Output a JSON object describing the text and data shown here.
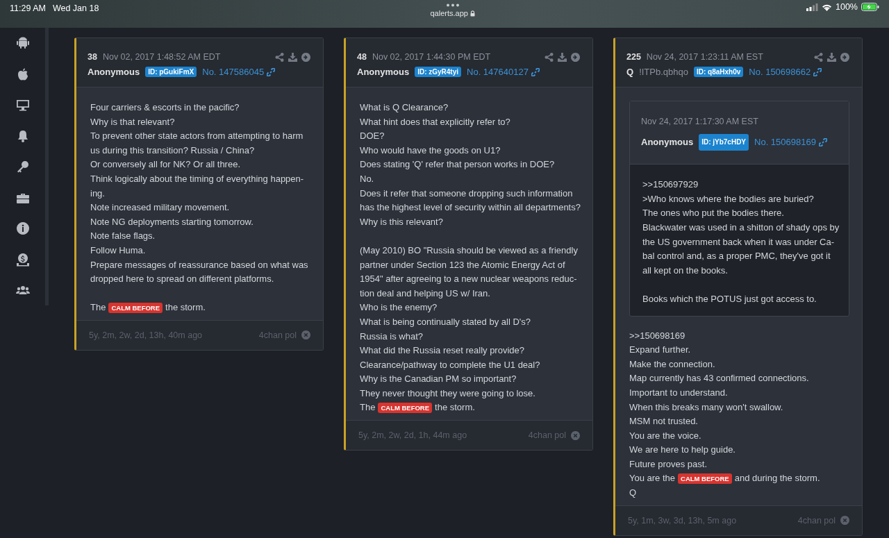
{
  "status_bar": {
    "time": "11:29 AM",
    "date": "Wed Jan 18",
    "url": "qalerts.app",
    "battery": "100%"
  },
  "posts": [
    {
      "number": "38",
      "date": "Nov 02, 2017 1:48:52 AM EDT",
      "author": "Anonymous",
      "id_badge": "ID: pGukiFmX",
      "post_no": "No. 147586045",
      "lines": [
        {
          "kind": "text",
          "text": "Four carriers & escorts in the pacific?"
        },
        {
          "kind": "text",
          "text": "Why is that relevant?"
        },
        {
          "kind": "text",
          "text": "To prevent other state actors from attempting to harm"
        },
        {
          "kind": "text",
          "text": "us during this transition? Russia / China?"
        },
        {
          "kind": "text",
          "text": "Or conversely all for NK? Or all three."
        },
        {
          "kind": "text",
          "text": "Think logically about the timing of everything happen-"
        },
        {
          "kind": "text",
          "text": "ing."
        },
        {
          "kind": "text",
          "text": "Note increased military movement."
        },
        {
          "kind": "text",
          "text": "Note NG deployments starting tomorrow."
        },
        {
          "kind": "text",
          "text": "Note false flags."
        },
        {
          "kind": "text",
          "text": "Follow Huma."
        },
        {
          "kind": "text",
          "text": "Prepare messages of reassurance based on what was"
        },
        {
          "kind": "text",
          "text": "dropped here to spread on different platforms."
        },
        {
          "kind": "gap"
        },
        {
          "kind": "badge",
          "before": "The",
          "badge": "CALM BEFORE",
          "after": "the storm."
        }
      ],
      "age": "5y, 2m, 2w, 2d, 13h, 40m ago",
      "source": "4chan pol"
    },
    {
      "number": "48",
      "date": "Nov 02, 2017 1:44:30 PM EDT",
      "author": "Anonymous",
      "id_badge": "ID: zGyR4tyi",
      "post_no": "No. 147640127",
      "lines": [
        {
          "kind": "text",
          "text": "What is Q Clearance?"
        },
        {
          "kind": "text",
          "text": "What hint does that explicitly refer to?"
        },
        {
          "kind": "text",
          "text": "DOE?"
        },
        {
          "kind": "text",
          "text": "Who would have the goods on U1?"
        },
        {
          "kind": "text",
          "text": "Does stating 'Q' refer that person works in DOE?"
        },
        {
          "kind": "text",
          "text": "No."
        },
        {
          "kind": "text",
          "text": "Does it refer that someone dropping such information"
        },
        {
          "kind": "text",
          "text": "has the highest level of security within all departments?"
        },
        {
          "kind": "text",
          "text": "Why is this relevant?"
        },
        {
          "kind": "gap"
        },
        {
          "kind": "text",
          "text": "(May 2010) BO \"Russia should be viewed as a friendly"
        },
        {
          "kind": "text",
          "text": "partner under Section 123 the Atomic Energy Act of"
        },
        {
          "kind": "text",
          "text": "1954\" after agreeing to a new nuclear weapons reduc-"
        },
        {
          "kind": "text",
          "text": "tion deal and helping US w/ Iran."
        },
        {
          "kind": "text",
          "text": "Who is the enemy?"
        },
        {
          "kind": "text",
          "text": "What is being continually stated by all D's?"
        },
        {
          "kind": "text",
          "text": "Russia is what?"
        },
        {
          "kind": "text",
          "text": "What did the Russia reset really provide?"
        },
        {
          "kind": "text",
          "text": "Clearance/pathway to complete the U1 deal?"
        },
        {
          "kind": "text",
          "text": "Why is the Canadian PM so important?"
        },
        {
          "kind": "text",
          "text": "They never thought they were going to lose."
        },
        {
          "kind": "badge",
          "before": "The",
          "badge": "CALM BEFORE",
          "after": "the storm."
        }
      ],
      "age": "5y, 2m, 2w, 2d, 1h, 44m ago",
      "source": "4chan pol"
    },
    {
      "number": "225",
      "date": "Nov 24, 2017 1:23:11 AM EST",
      "author": "Q",
      "tripcode": "!ITPb.qbhqo",
      "id_badge": "ID: q8aHxh0v",
      "post_no": "No. 150698662",
      "quote": {
        "date": "Nov 24, 2017 1:17:30 AM EST",
        "author": "Anonymous",
        "id_badge": "ID: jYb7cHDY",
        "post_no": "No. 150698169",
        "lines": [
          {
            "kind": "text",
            "text": ">>150697929"
          },
          {
            "kind": "text",
            "text": ">Who knows where the bodies are buried?"
          },
          {
            "kind": "text",
            "text": "The ones who put the bodies there."
          },
          {
            "kind": "text",
            "text": "Blackwater was used in a shitton of shady ops by"
          },
          {
            "kind": "text",
            "text": "the US government back when it was under Ca-"
          },
          {
            "kind": "text",
            "text": "bal control and, as a proper PMC, they've got it"
          },
          {
            "kind": "text",
            "text": "all kept on the books."
          },
          {
            "kind": "gap"
          },
          {
            "kind": "text",
            "text": "Books which the POTUS just got access to."
          }
        ]
      },
      "lines": [
        {
          "kind": "text",
          "text": ">>150698169"
        },
        {
          "kind": "text",
          "text": "Expand further."
        },
        {
          "kind": "text",
          "text": "Make the connection."
        },
        {
          "kind": "text",
          "text": "Map currently has 43 confirmed connections."
        },
        {
          "kind": "text",
          "text": "Important to understand."
        },
        {
          "kind": "text",
          "text": "When this breaks many won't swallow."
        },
        {
          "kind": "text",
          "text": "MSM not trusted."
        },
        {
          "kind": "text",
          "text": "You are the voice."
        },
        {
          "kind": "text",
          "text": "We are here to help guide."
        },
        {
          "kind": "text",
          "text": "Future proves past."
        },
        {
          "kind": "badge",
          "before": "You are the",
          "badge": "CALM BEFORE",
          "after": "and during the storm."
        },
        {
          "kind": "text",
          "text": "Q"
        }
      ],
      "age": "5y, 1m, 3w, 3d, 13h, 5m ago",
      "source": "4chan pol"
    }
  ]
}
